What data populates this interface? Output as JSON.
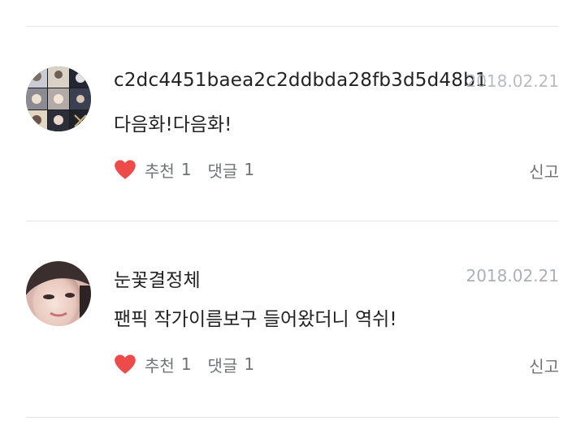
{
  "comments": [
    {
      "author": "c2dc4451baea2c2ddbda28fb3d5d48b1",
      "date": "2018.02.21",
      "text": "다음화!다음화!",
      "like_label": "추천",
      "like_count": "1",
      "reply_label": "댓글",
      "reply_count": "1",
      "report_label": "신고",
      "avatar_icon": "photo-collage-avatar"
    },
    {
      "author": "눈꽃결정체",
      "date": "2018.02.21",
      "text": "팬픽 작가이름보구 들어왔더니 역쉬!",
      "like_label": "추천",
      "like_count": "1",
      "reply_label": "댓글",
      "reply_count": "1",
      "report_label": "신고",
      "avatar_icon": "portrait-avatar"
    }
  ],
  "colors": {
    "heart": "#ef4a4a",
    "date": "#aab0b8",
    "meta": "#6f7378",
    "text": "#222222",
    "divider": "#e6e6e6"
  }
}
